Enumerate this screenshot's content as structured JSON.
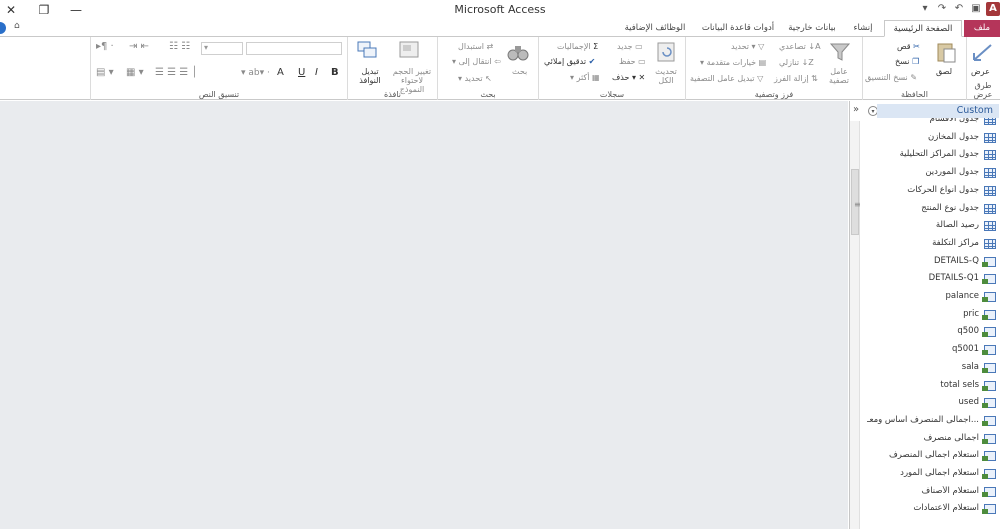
{
  "window": {
    "title": "Microsoft Access",
    "close_glyph": "✕",
    "restore_glyph": "❐",
    "minimize_glyph": "—",
    "app_icon_letter": "A",
    "undo_glyph": "↶",
    "redo_glyph": "↷",
    "customize_glyph": "▾",
    "save_glyph": "▣"
  },
  "tabs": [
    {
      "label": "ملف",
      "active": false,
      "file": true
    },
    {
      "label": "الصفحة الرئيسية",
      "active": true,
      "file": false
    },
    {
      "label": "إنشاء",
      "active": false,
      "file": false
    },
    {
      "label": "بيانات خارجية",
      "active": false,
      "file": false
    },
    {
      "label": "أدوات قاعدة البيانات",
      "active": false,
      "file": false
    },
    {
      "label": "الوظائف الإضافية",
      "active": false,
      "file": false
    }
  ],
  "ribbon": {
    "views": {
      "label": "طرق عرض",
      "button": "عرض"
    },
    "clipboard": {
      "label": "الحافظة",
      "paste": "لصق",
      "cut": "قص",
      "copy": "نسخ",
      "format_painter": "نسخ التنسيق"
    },
    "sort_filter": {
      "label": "فرز وتصفية",
      "filter": "عامل تصفية",
      "ascending": "تصاعدي",
      "descending": "تنازلي",
      "remove_sort": "إزالة الفرز",
      "selection": "تحديد",
      "advanced": "خيارات متقدمة",
      "toggle_filter": "تبديل عامل التصفية"
    },
    "records": {
      "label": "سجلات",
      "refresh_all": "تحديث الكل",
      "new": "جديد",
      "save": "حفظ",
      "delete": "حذف",
      "totals": "الإجماليات",
      "spelling": "تدقيق إملائي",
      "more": "أكثر"
    },
    "find": {
      "label": "بحث",
      "find": "بحث",
      "replace": "استبدال",
      "goto": "انتقال إلى",
      "select": "تحديد"
    },
    "window": {
      "label": "نافذة",
      "size_to_fit": "تغيير الحجم لاحتواء النموذج",
      "switch_windows": "تبديل النوافذ"
    },
    "text_formatting": {
      "label": "تنسيق النص",
      "bold": "B",
      "italic": "I",
      "underline": "U",
      "font_color": "A"
    }
  },
  "nav": {
    "title": "Custom",
    "collapse_glyph": "»",
    "menu_glyph": "▾",
    "items": [
      {
        "label": "جدول الأقسام",
        "type": "table"
      },
      {
        "label": "جدول المخازن",
        "type": "table"
      },
      {
        "label": "جدول المراكز التحليلية",
        "type": "table"
      },
      {
        "label": "جدول الموردين",
        "type": "table"
      },
      {
        "label": "جدول أنواع الحركات",
        "type": "table"
      },
      {
        "label": "جدول نوع المنتج",
        "type": "table"
      },
      {
        "label": "رصيد الصالة",
        "type": "table"
      },
      {
        "label": "مراكز التكلفة",
        "type": "table"
      },
      {
        "label": "DETAILS-Q",
        "type": "query"
      },
      {
        "label": "DETAILS-Q1",
        "type": "query"
      },
      {
        "label": "palance",
        "type": "query"
      },
      {
        "label": "pric",
        "type": "query"
      },
      {
        "label": "q500",
        "type": "query"
      },
      {
        "label": "q5001",
        "type": "query"
      },
      {
        "label": "sala",
        "type": "query"
      },
      {
        "label": "total sels",
        "type": "query"
      },
      {
        "label": "used",
        "type": "query"
      },
      {
        "label": "اجمالى المنصرف اساس ومعـ...",
        "type": "query"
      },
      {
        "label": "اجمالى منصرف",
        "type": "query"
      },
      {
        "label": "استعلام اجمالى المنصرف",
        "type": "query"
      },
      {
        "label": "استعلام اجمالى المورد",
        "type": "query"
      },
      {
        "label": "استعلام الأصناف",
        "type": "query"
      },
      {
        "label": "استعلام الاعتمادات",
        "type": "query"
      }
    ]
  }
}
